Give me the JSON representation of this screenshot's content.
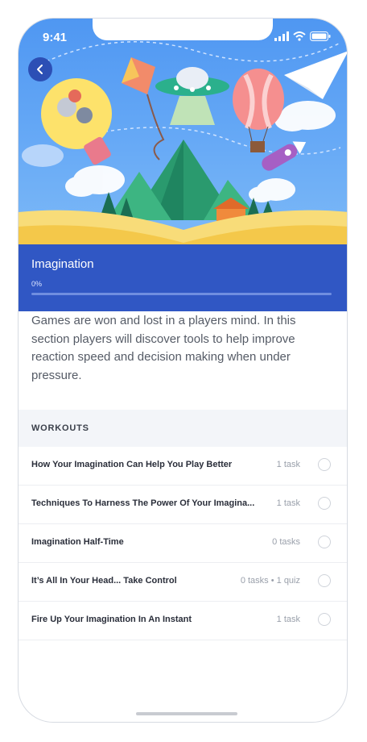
{
  "status": {
    "time": "9:41"
  },
  "hero": {
    "back_icon": "chevron-left-icon"
  },
  "course": {
    "title": "Imagination",
    "progress_label": "0%",
    "progress_value": 0,
    "description": "Games are won and lost in a players mind. In this section players will discover tools to help improve reaction speed and decision making when under pressure."
  },
  "workouts": {
    "header": "WORKOUTS",
    "items": [
      {
        "title": "How Your Imagination Can Help You Play Better",
        "meta": "1 task"
      },
      {
        "title": "Techniques To Harness The Power Of Your Imagina...",
        "meta": "1 task"
      },
      {
        "title": "Imagination Half-Time",
        "meta": "0 tasks"
      },
      {
        "title": "It’s All In Your Head... Take Control",
        "meta": "0 tasks • 1 quiz"
      },
      {
        "title": "Fire Up Your Imagination In An Instant",
        "meta": "1 task"
      }
    ]
  },
  "colors": {
    "accent": "#3057c4",
    "hero_sky": "#5a9ff3",
    "back_button": "#2c4fb5"
  }
}
